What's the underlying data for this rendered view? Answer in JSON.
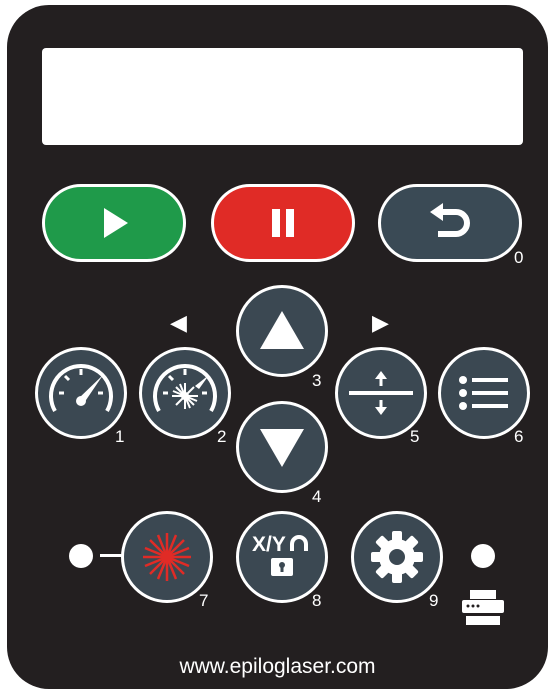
{
  "buttons": {
    "start": {
      "icon": "play-icon",
      "color": "#1f9a4a"
    },
    "stop": {
      "icon": "pause-icon",
      "color": "#e02b26"
    },
    "reset": {
      "icon": "return-icon",
      "color": "#3a4a55",
      "number": "0"
    },
    "speed": {
      "icon": "speedometer-icon",
      "number": "1"
    },
    "power": {
      "icon": "laser-power-gauge-icon",
      "number": "2"
    },
    "up": {
      "icon": "arrow-up-icon",
      "number": "3"
    },
    "down": {
      "icon": "arrow-down-icon",
      "number": "4"
    },
    "focus": {
      "icon": "focus-icon",
      "number": "5"
    },
    "menu": {
      "icon": "menu-list-icon",
      "number": "6"
    },
    "pointer": {
      "icon": "laser-pointer-icon",
      "number": "7"
    },
    "xy_unlock": {
      "icon": "xy-unlock-icon",
      "label": "X/Y",
      "number": "8"
    },
    "settings": {
      "icon": "gear-icon",
      "number": "9"
    }
  },
  "hints": {
    "left": "◀",
    "right": "▶"
  },
  "indicators": {
    "pointer_led": "led",
    "job_led": "led",
    "printer_icon": "printer-icon"
  },
  "footer": {
    "url": "www.epiloglaser.com"
  },
  "colors": {
    "panel": "#231f20",
    "button": "#3b4852",
    "laser_red": "#e02b26"
  }
}
